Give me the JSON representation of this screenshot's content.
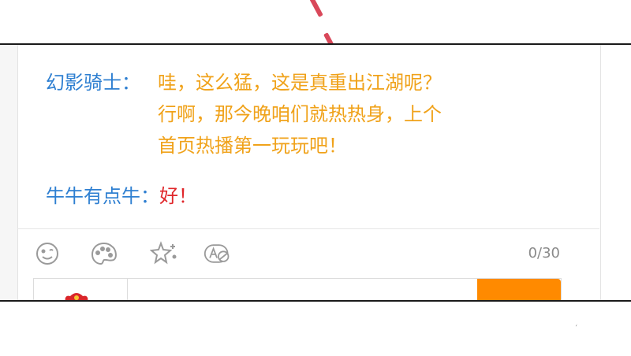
{
  "messages": [
    {
      "sender": "幻影骑士：",
      "lines": [
        "哇，这么猛，这是真重出江湖呢？",
        "行啊，那今晚咱们就热热身，上个",
        "首页热播第一玩玩吧！"
      ]
    },
    {
      "sender": "牛牛有点牛：",
      "text": "好！"
    }
  ],
  "toolbar": {
    "icons": [
      "smiley-icon",
      "palette-icon",
      "sparkle-icon",
      "text-style-icon"
    ],
    "counter": "0/30"
  },
  "colors": {
    "sender": "#2e7fd1",
    "message_yellow": "#f0a21a",
    "message_red": "#e0262a",
    "send_button": "#ff8a00"
  }
}
